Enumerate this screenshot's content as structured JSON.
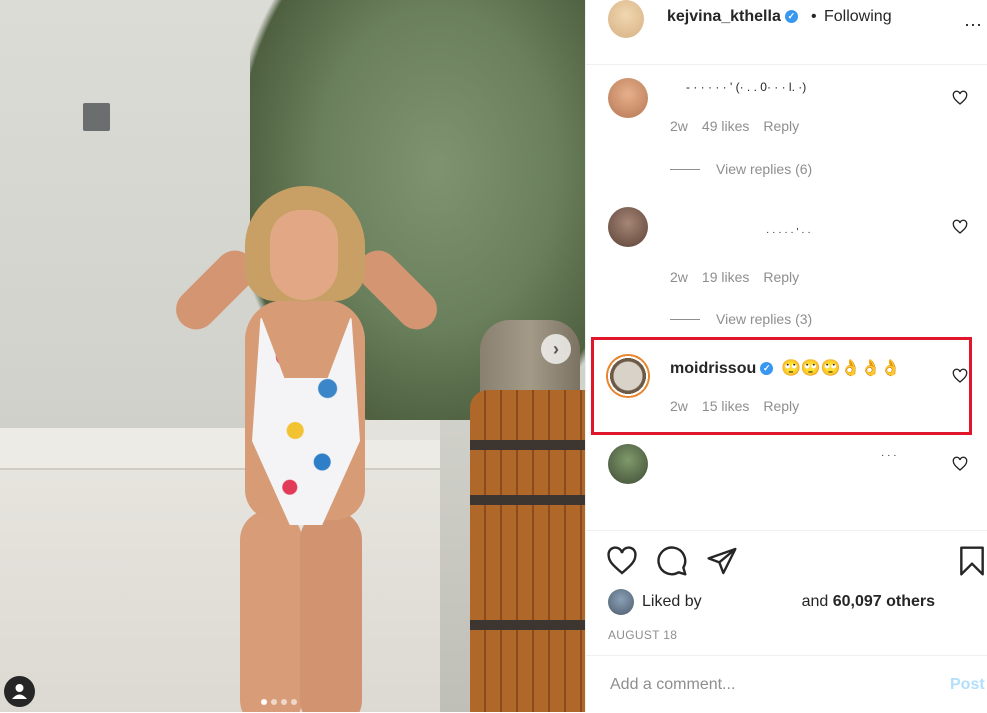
{
  "post": {
    "owner": "kejvina_kthella",
    "follow_separator": "•",
    "follow_status": "Following",
    "more_icon": "⋯"
  },
  "comments": [
    {
      "user": "",
      "text": "- · · · · · ' (· . . 0· · · l. ·)",
      "time": "2w",
      "likes": "49 likes",
      "reply": "Reply",
      "view_replies": "View replies (6)"
    },
    {
      "user": "",
      "text": "· · · · · ' · ·",
      "time": "2w",
      "likes": "19 likes",
      "reply": "Reply",
      "view_replies": "View replies (3)"
    },
    {
      "user": "moidrissou",
      "verified": true,
      "text": "🙄🙄🙄👌👌👌",
      "time": "2w",
      "likes": "15 likes",
      "reply": "Reply"
    },
    {
      "user": "",
      "text": "· · ·",
      "time": "",
      "likes": "",
      "reply": ""
    }
  ],
  "likes": {
    "prefix": "Liked by",
    "suffix_and": "and",
    "others": "60,097 others"
  },
  "date": "AUGUST 18",
  "add_comment": {
    "placeholder": "Add a comment...",
    "post_label": "Post"
  },
  "colors": {
    "accent": "#3897f0",
    "highlight": "#e0162b",
    "muted": "#8e8e8e",
    "post_disabled": "#b2dffc"
  },
  "icons": {
    "like": "heart-outline",
    "comment": "speech-bubble",
    "share": "paper-plane",
    "save": "bookmark-outline",
    "carousel_next": "chevron-right",
    "tagged_user": "person"
  },
  "carousel": {
    "total": 4,
    "current": 1
  }
}
